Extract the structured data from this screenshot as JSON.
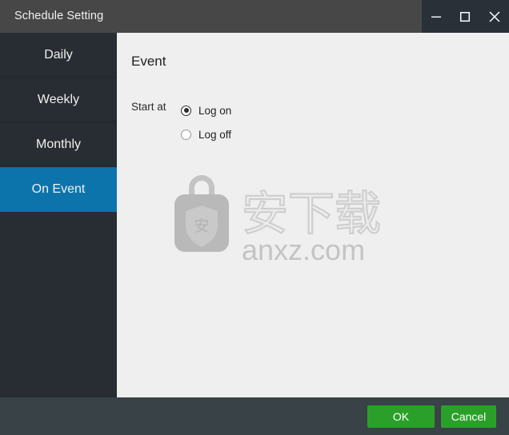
{
  "window": {
    "title": "Schedule Setting",
    "controls": [
      {
        "name": "minimize",
        "glyph": "minimize-icon"
      },
      {
        "name": "maximize",
        "glyph": "maximize-icon"
      },
      {
        "name": "close",
        "glyph": "close-icon"
      }
    ]
  },
  "sidebar": {
    "items": [
      {
        "label": "Daily",
        "active": false
      },
      {
        "label": "Weekly",
        "active": false
      },
      {
        "label": "Monthly",
        "active": false
      },
      {
        "label": "On Event",
        "active": true
      }
    ]
  },
  "main": {
    "section_title": "Event",
    "start_at_label": "Start at",
    "options": [
      {
        "label": "Log on",
        "selected": true
      },
      {
        "label": "Log off",
        "selected": false
      }
    ]
  },
  "watermark": {
    "cn_text": "安下载",
    "domain_text": "anxz.com",
    "bag_icon": "shopping-bag-icon"
  },
  "footer": {
    "ok_label": "OK",
    "cancel_label": "Cancel"
  },
  "colors": {
    "titlebar": "#474747",
    "window_controls_bg": "#2a3038",
    "sidebar": "#282d33",
    "accent_blue": "#0d74ab",
    "content_bg": "#efefef",
    "footer": "#394247",
    "button_green": "#2aa02a",
    "watermark_gray": "#c9c9c9"
  }
}
